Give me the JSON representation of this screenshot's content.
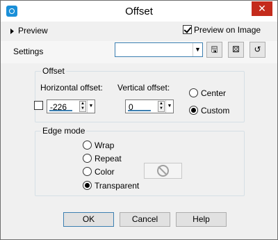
{
  "window": {
    "title": "Offset",
    "close_glyph": "✕"
  },
  "top": {
    "preview_label": "Preview",
    "preview_on_image_label": "Preview on Image",
    "preview_on_image_checked": true
  },
  "settings": {
    "label": "Settings",
    "preset_value": "",
    "toolbar_icons": [
      "save-preset-icon",
      "randomize-icon",
      "reset-icon"
    ]
  },
  "offset": {
    "caption": "Offset",
    "horizontal_label": "Horizontal offset:",
    "horizontal_value": "-226",
    "vertical_label": "Vertical offset:",
    "vertical_value": "0",
    "link_checked": false,
    "center_label": "Center",
    "custom_label": "Custom",
    "selected": "Custom"
  },
  "edge_mode": {
    "caption": "Edge mode",
    "options": [
      "Wrap",
      "Repeat",
      "Color",
      "Transparent"
    ],
    "selected": "Transparent"
  },
  "buttons": {
    "ok": "OK",
    "cancel": "Cancel",
    "help": "Help"
  }
}
